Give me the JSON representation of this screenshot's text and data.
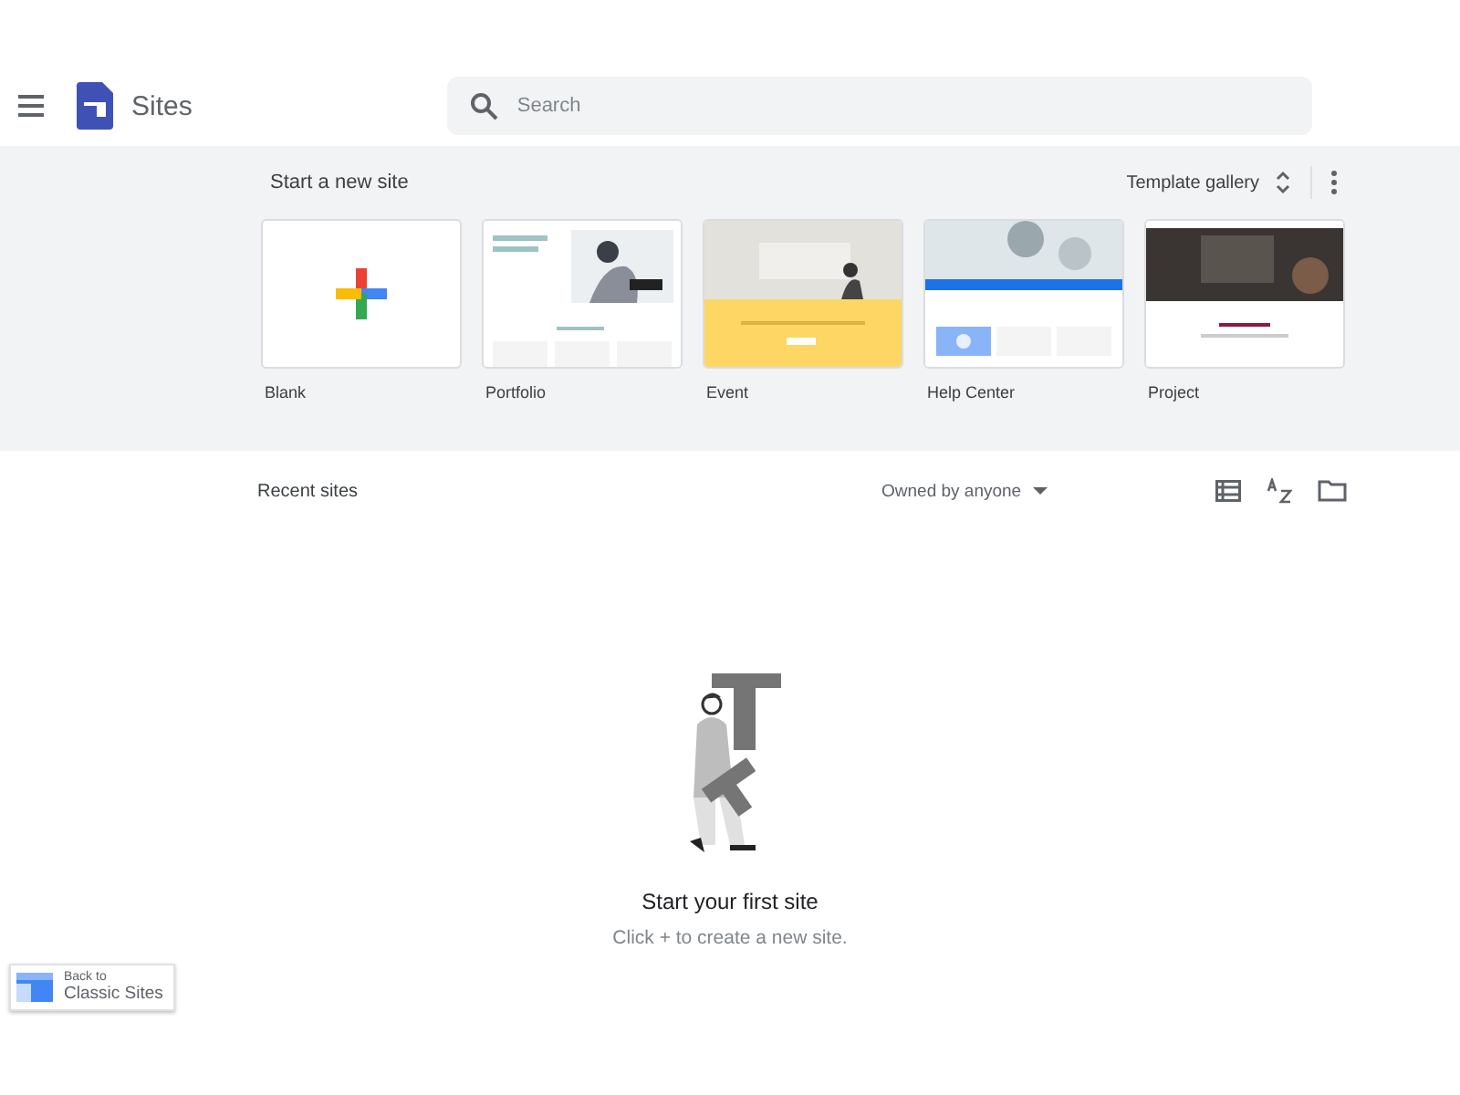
{
  "app": {
    "title": "Sites"
  },
  "search": {
    "placeholder": "Search"
  },
  "templates_section": {
    "title": "Start a new site",
    "gallery_label": "Template gallery",
    "templates": [
      {
        "label": "Blank",
        "kind": "blank"
      },
      {
        "label": "Portfolio",
        "kind": "portfolio"
      },
      {
        "label": "Event",
        "kind": "event"
      },
      {
        "label": "Help Center",
        "kind": "help"
      },
      {
        "label": "Project",
        "kind": "project"
      }
    ]
  },
  "recent": {
    "title": "Recent sites",
    "owner_filter": "Owned by anyone"
  },
  "empty_state": {
    "title": "Start your first site",
    "hint": "Click + to create a new site."
  },
  "classic_button": {
    "line_1": "Back to",
    "line_2": "Classic Sites"
  }
}
